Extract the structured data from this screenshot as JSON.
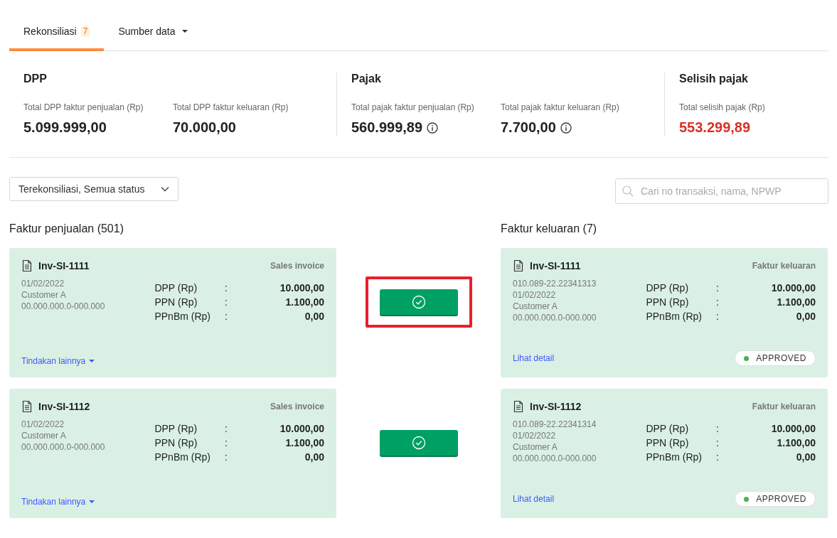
{
  "tabs": [
    {
      "label": "Rekonsiliasi",
      "badge": "7",
      "selected": true,
      "dropdown": false
    },
    {
      "label": "Sumber data",
      "selected": false,
      "dropdown": true
    }
  ],
  "summary": [
    {
      "title": "DPP",
      "metrics": [
        {
          "label": "Total DPP faktur penjualan (Rp)",
          "value": "5.099.999,00",
          "info": false,
          "kind": "normal"
        },
        {
          "label": "Total DPP faktur keluaran (Rp)",
          "value": "70.000,00",
          "info": false,
          "kind": "normal"
        }
      ]
    },
    {
      "title": "Pajak",
      "metrics": [
        {
          "label": "Total pajak faktur penjualan (Rp)",
          "value": "560.999,89",
          "info": true,
          "kind": "normal"
        },
        {
          "label": "Total pajak faktur keluaran (Rp)",
          "value": "7.700,00",
          "info": true,
          "kind": "normal"
        }
      ]
    },
    {
      "title": "Selisih pajak",
      "metrics": [
        {
          "label": "Total selisih pajak (Rp)",
          "value": "553.299,89",
          "info": false,
          "kind": "alert"
        }
      ]
    }
  ],
  "filter": {
    "value": "Terekonsiliasi, Semua status"
  },
  "search": {
    "placeholder": "Cari no transaksi, nama, NPWP"
  },
  "left_heading": "Faktur penjualan (501)",
  "right_heading": "Faktur keluaran (7)",
  "pairs": [
    {
      "highlighted": true,
      "left": {
        "number": "Inv-SI-1111",
        "type": "Sales invoice",
        "lines": [
          "01/02/2022",
          "Customer A",
          "00.000.000.0-000.000"
        ],
        "amounts": [
          {
            "label": "DPP (Rp)",
            "separator": ":",
            "value": "10.000,00"
          },
          {
            "label": "PPN (Rp)",
            "separator": ":",
            "value": "1.100,00"
          },
          {
            "label": "PPnBm (Rp)",
            "separator": ":",
            "value": "0,00"
          }
        ],
        "action": "Tindakan lainnya"
      },
      "right": {
        "number": "Inv-SI-1111",
        "type": "Faktur keluaran",
        "lines": [
          "010.089-22.22341313",
          "01/02/2022",
          "Customer A",
          "00.000.000.0-000.000"
        ],
        "amounts": [
          {
            "label": "DPP (Rp)",
            "separator": ":",
            "value": "10.000,00"
          },
          {
            "label": "PPN (Rp)",
            "separator": ":",
            "value": "1.100,00"
          },
          {
            "label": "PPnBm (Rp)",
            "separator": ":",
            "value": "0,00"
          }
        ],
        "link": "Lihat detail",
        "status": {
          "label": "APPROVED",
          "color": "#4caf50"
        }
      }
    },
    {
      "highlighted": false,
      "left": {
        "number": "Inv-SI-1112",
        "type": "Sales invoice",
        "lines": [
          "01/02/2022",
          "Customer A",
          "00.000.000.0-000.000"
        ],
        "amounts": [
          {
            "label": "DPP (Rp)",
            "separator": ":",
            "value": "10.000,00"
          },
          {
            "label": "PPN (Rp)",
            "separator": ":",
            "value": "1.100,00"
          },
          {
            "label": "PPnBm (Rp)",
            "separator": ":",
            "value": "0,00"
          }
        ],
        "action": "Tindakan lainnya"
      },
      "right": {
        "number": "Inv-SI-1112",
        "type": "Faktur keluaran",
        "lines": [
          "010.089-22.22341314",
          "01/02/2022",
          "Customer A",
          "00.000.000.0-000.000"
        ],
        "amounts": [
          {
            "label": "DPP (Rp)",
            "separator": ":",
            "value": "10.000,00"
          },
          {
            "label": "PPN (Rp)",
            "separator": ":",
            "value": "1.100,00"
          },
          {
            "label": "PPnBm (Rp)",
            "separator": ":",
            "value": "0,00"
          }
        ],
        "link": "Lihat detail",
        "status": {
          "label": "APPROVED",
          "color": "#4caf50"
        }
      }
    }
  ]
}
